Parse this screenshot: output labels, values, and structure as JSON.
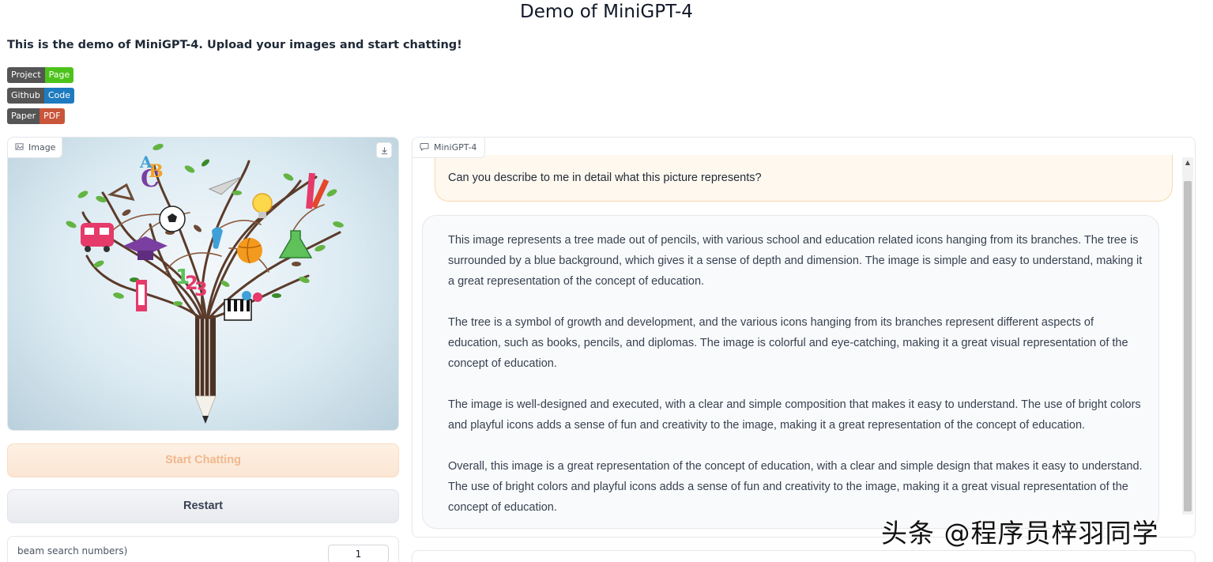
{
  "header": {
    "title": "Demo of MiniGPT-4",
    "description": "This is the demo of MiniGPT-4. Upload your images and start chatting!"
  },
  "badges": [
    {
      "left": "Project",
      "right": "Page",
      "right_color": "#4cc31a"
    },
    {
      "left": "Github",
      "right": "Code",
      "right_color": "#1e7bbf"
    },
    {
      "left": "Paper",
      "right": "PDF",
      "right_color": "#c9553a"
    }
  ],
  "image_panel": {
    "label": "Image",
    "icon": "image-icon",
    "download_icon": "download-icon"
  },
  "buttons": {
    "start": "Start Chatting",
    "restart": "Restart"
  },
  "beam": {
    "label": "beam search numbers)",
    "value": "1"
  },
  "chat": {
    "label": "MiniGPT-4",
    "icon": "chat-icon",
    "user_message": "Can you describe to me in detail what this picture represents?",
    "bot_paragraphs": [
      "This image represents a tree made out of pencils, with various school and education related icons hanging from its branches. The tree is surrounded by a blue background, which gives it a sense of depth and dimension. The image is simple and easy to understand, making it a great representation of the concept of education.",
      "The tree is a symbol of growth and development, and the various icons hanging from its branches represent different aspects of education, such as books, pencils, and diplomas. The image is colorful and eye-catching, making it a great visual representation of the concept of education.",
      "The image is well-designed and executed, with a clear and simple composition that makes it easy to understand. The use of bright colors and playful icons adds a sense of fun and creativity to the image, making it a great representation of the concept of education.",
      "Overall, this image is a great representation of the concept of education, with a clear and simple design that makes it easy to understand. The use of bright colors and playful icons adds a sense of fun and creativity to the image, making it a great visual representation of the concept of education."
    ]
  },
  "watermark": "头条 @程序员梓羽同学"
}
